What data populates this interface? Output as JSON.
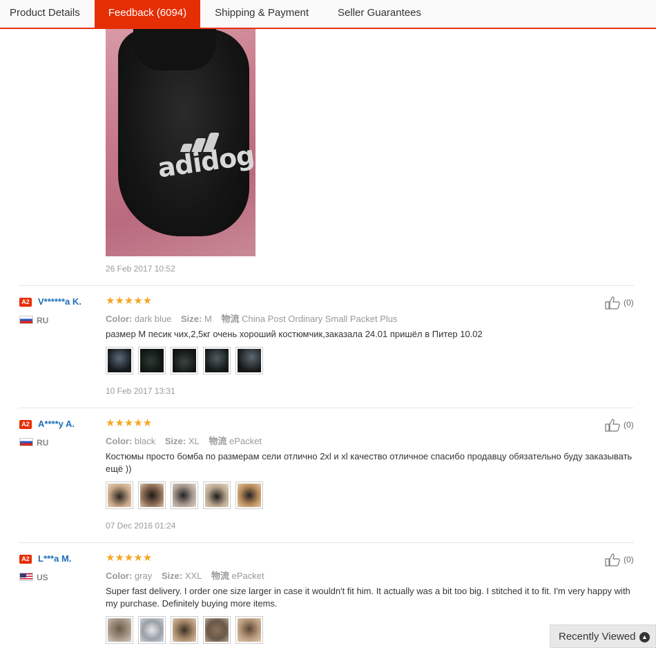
{
  "tabs": [
    {
      "label": "Product Details"
    },
    {
      "label": "Feedback (6094)"
    },
    {
      "label": "Shipping & Payment"
    },
    {
      "label": "Seller Guarantees"
    }
  ],
  "top_photo": {
    "logo_text": "adidog",
    "date": "26 Feb 2017 10:52"
  },
  "reviews": [
    {
      "badge": "A2",
      "user": "V******a K.",
      "country": "RU",
      "stars": "★★★★★",
      "color_label": "Color:",
      "color": "dark blue",
      "size_label": "Size:",
      "size": "M",
      "ship_label": "物流",
      "shipping": "China Post Ordinary Small Packet Plus",
      "text": "размер М песик чих,2,5кг очень хороший костюмчик,заказала 24.01 пришёл в Питер 10.02",
      "date": "10 Feb 2017 13:31",
      "helpful": "(0)"
    },
    {
      "badge": "A2",
      "user": "A****y A.",
      "country": "RU",
      "stars": "★★★★★",
      "color_label": "Color:",
      "color": "black",
      "size_label": "Size:",
      "size": "XL",
      "ship_label": "物流",
      "shipping": "ePacket",
      "text": "Костюмы просто бомба по размерам сели отлично 2xl и xl качество отличное спасибо продавцу обязательно буду заказывать ещё ))",
      "date": "07 Dec 2016 01:24",
      "helpful": "(0)"
    },
    {
      "badge": "A2",
      "user": "L***a M.",
      "country": "US",
      "stars": "★★★★★",
      "color_label": "Color:",
      "color": "gray",
      "size_label": "Size:",
      "size": "XXL",
      "ship_label": "物流",
      "shipping": "ePacket",
      "text": "Super fast delivery. I order one size larger in case it wouldn't fit him. It actually was a bit too big. I stitched it to fit. I'm very happy with my purchase. Definitely buying more items.",
      "helpful": "(0)"
    }
  ],
  "recently_viewed": {
    "label": "Recently Viewed"
  },
  "colors": {
    "accent": "#e62e04",
    "star": "#f5a623",
    "link": "#1a6eb8"
  }
}
